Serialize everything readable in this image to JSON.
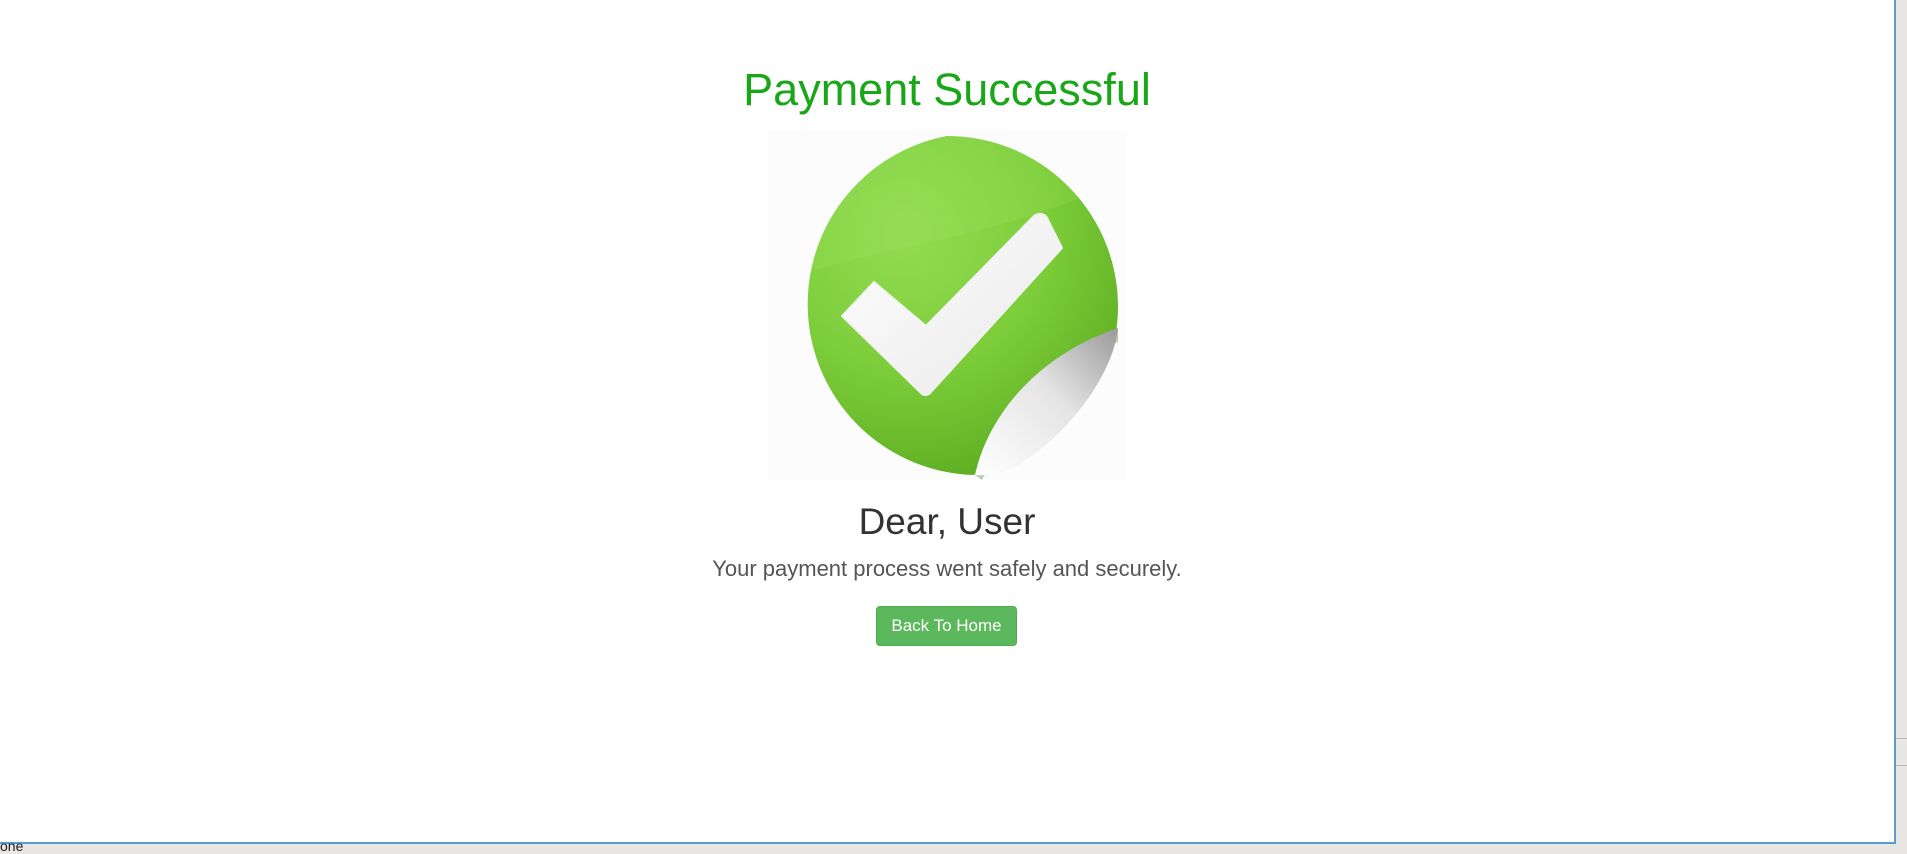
{
  "page": {
    "title": "Payment Successful",
    "greeting": "Dear, User",
    "message": "Your payment process went safely and securely.",
    "button_label": "Back To Home"
  },
  "status_fragment": "one",
  "icons": {
    "success_badge": "check-sticker-icon"
  },
  "colors": {
    "title": "#1aa619",
    "button": "#5cb85c",
    "badge": "#76c632"
  }
}
